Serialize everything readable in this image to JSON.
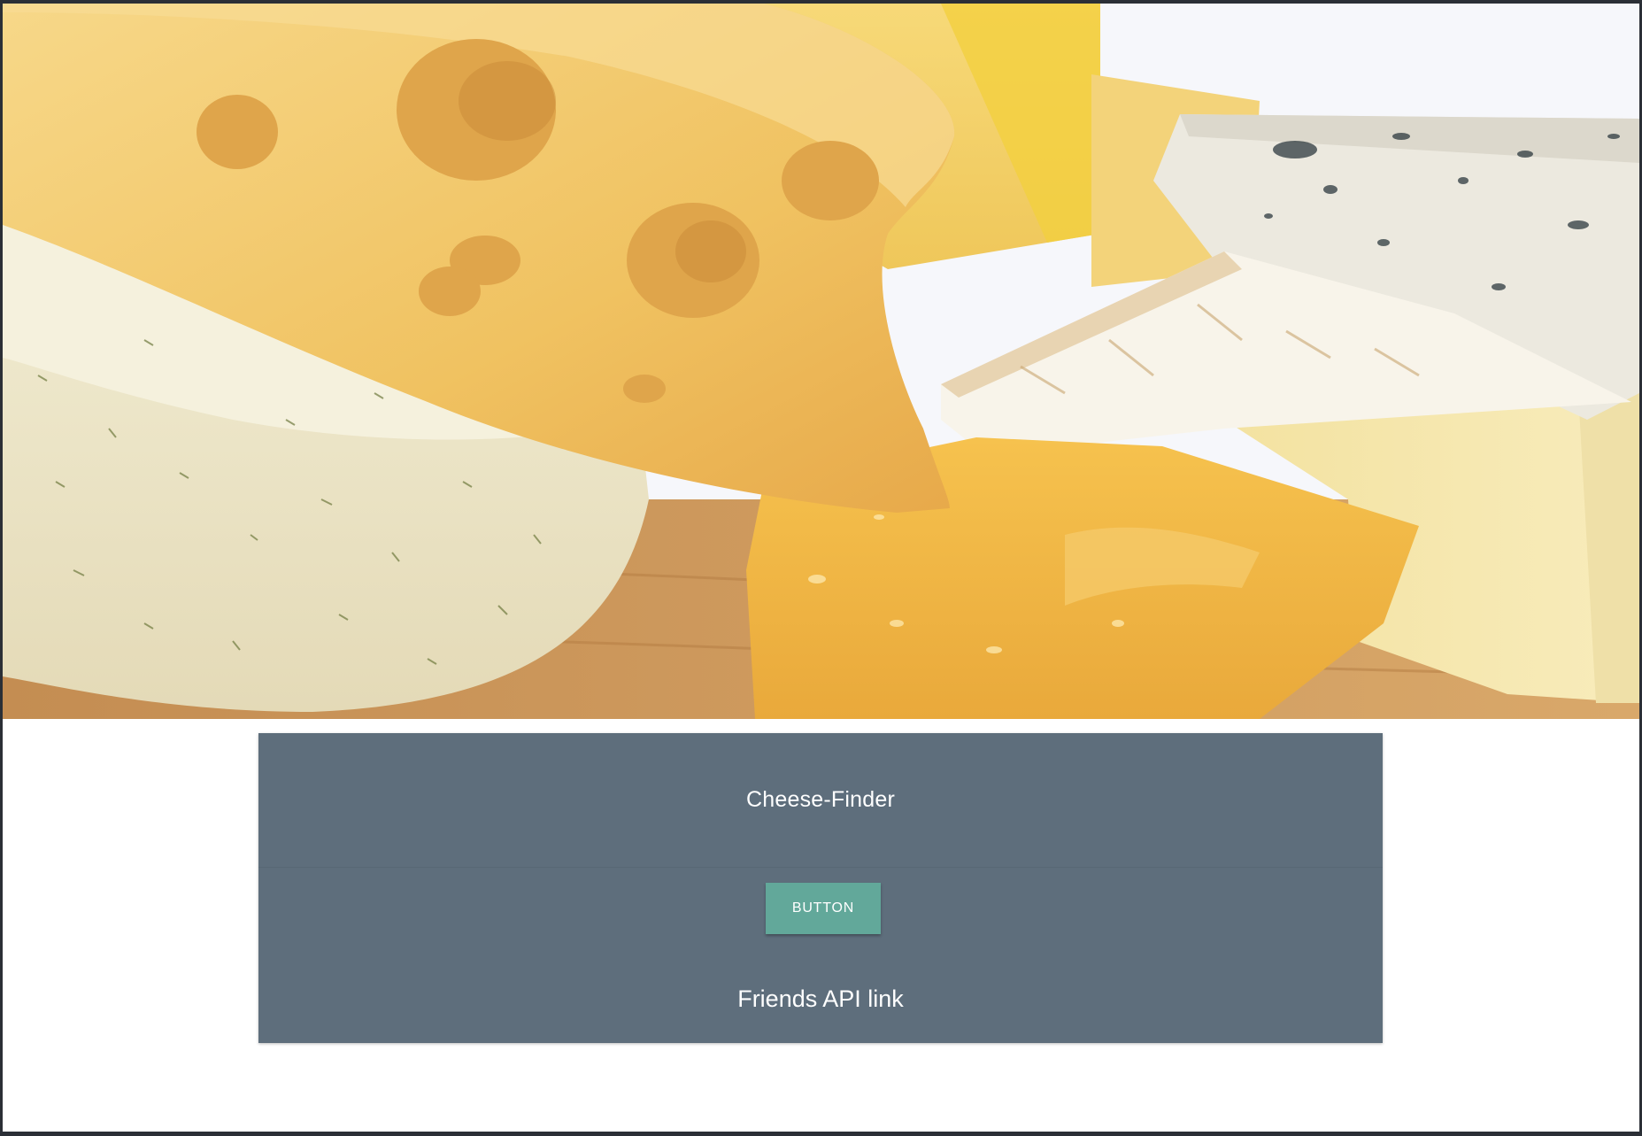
{
  "hero": {
    "image_name": "cheese-platter-image",
    "colors": {
      "swiss": "#f2c66a",
      "cheddar": "#f0b93f",
      "herb": "#ece5c7",
      "brie": "#f7f2e7",
      "blue": "#e9e6dd",
      "board": "#c9955a"
    }
  },
  "card": {
    "title": "Cheese-Finder",
    "button_label": "Button",
    "link_text": "Friends API link"
  },
  "theme": {
    "card_bg": "#5e6e7c",
    "button_bg": "#62a89a",
    "text": "#ffffff"
  }
}
